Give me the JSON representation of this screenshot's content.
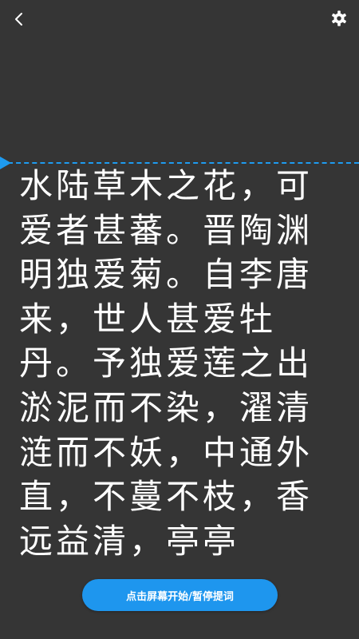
{
  "header": {
    "back_icon": "chevron-left-icon",
    "settings_icon": "gear-icon"
  },
  "colors": {
    "background": "#353535",
    "text": "#ffffff",
    "accent": "#1e96ee",
    "guide_line": "#1e9bf0"
  },
  "script": {
    "text": "水陆草木之花，可爱者甚蕃。晋陶渊明独爱菊。自李唐来，世人甚爱牡丹。予独爱莲之出淤泥而不染，濯清涟而不妖，中通外直，不蔓不枝，香远益清，亭亭"
  },
  "controls": {
    "start_pause_label": "点击屏幕开始/暂停提词"
  }
}
